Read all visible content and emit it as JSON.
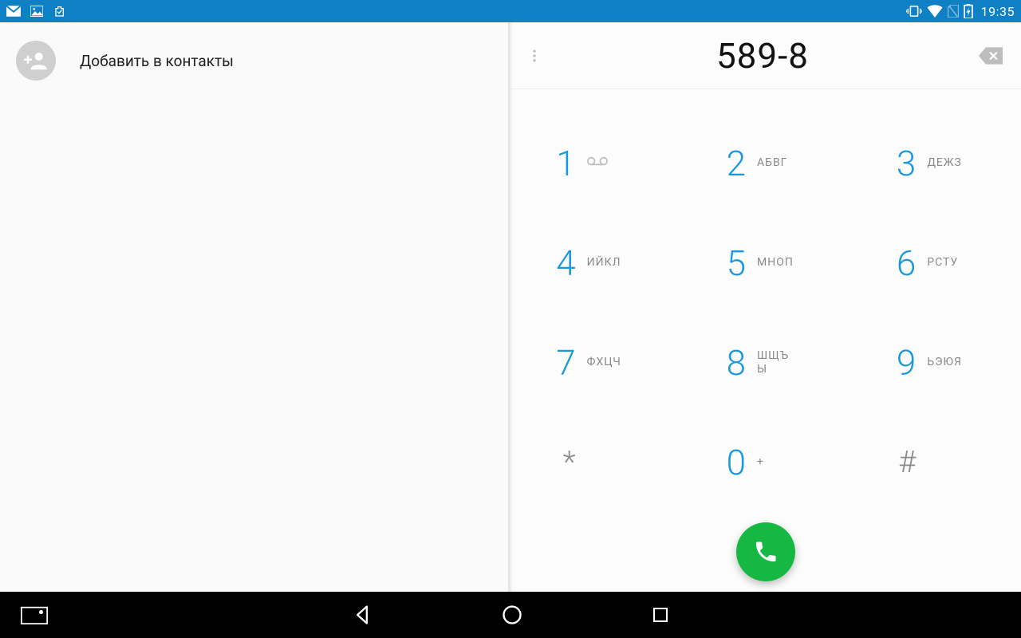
{
  "statusbar": {
    "time": "19:35"
  },
  "left": {
    "add_contact_label": "Добавить в контакты"
  },
  "dialer": {
    "number_display": "589-8",
    "keys": [
      {
        "digit": "1",
        "letters": "",
        "voicemail": true
      },
      {
        "digit": "2",
        "letters": "АБВГ"
      },
      {
        "digit": "3",
        "letters": "ДЕЖЗ"
      },
      {
        "digit": "4",
        "letters": "ИЙКЛ"
      },
      {
        "digit": "5",
        "letters": "МНОП"
      },
      {
        "digit": "6",
        "letters": "РСТУ"
      },
      {
        "digit": "7",
        "letters": "ФХЦЧ"
      },
      {
        "digit": "8",
        "letters": "ШЩЪЫ",
        "twoLine": true
      },
      {
        "digit": "9",
        "letters": "ЬЭЮЯ"
      },
      {
        "digit": "*",
        "letters": "",
        "symbol": true
      },
      {
        "digit": "0",
        "letters": "+"
      },
      {
        "digit": "#",
        "letters": "",
        "symbol": true
      }
    ]
  }
}
